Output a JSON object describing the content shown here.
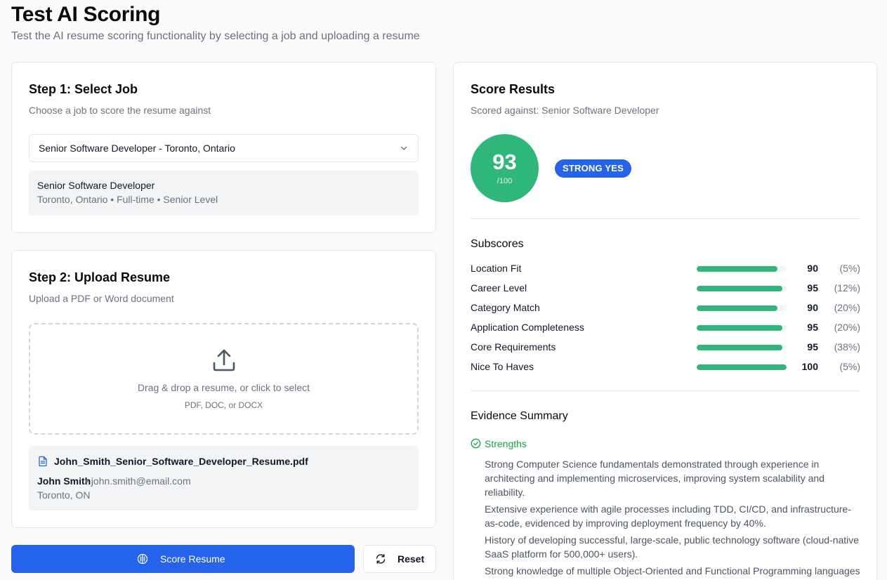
{
  "page": {
    "title": "Test AI Scoring",
    "subtitle": "Test the AI resume scoring functionality by selecting a job and uploading a resume"
  },
  "step1": {
    "title": "Step 1: Select Job",
    "description": "Choose a job to score the resume against",
    "selected_job": "Senior Software Developer - Toronto, Ontario",
    "job_title": "Senior Software Developer",
    "job_meta": "Toronto, Ontario • Full-time • Senior Level"
  },
  "step2": {
    "title": "Step 2: Upload Resume",
    "description": "Upload a PDF or Word document",
    "dropzone_text": "Drag & drop a resume, or click to select",
    "dropzone_hint": "PDF, DOC, or DOCX",
    "file_name": "John_Smith_Senior_Software_Developer_Resume.pdf",
    "candidate_name": "John Smith",
    "candidate_email": "• john.smith@email.com",
    "candidate_location": "Toronto, ON"
  },
  "actions": {
    "score_label": "Score Resume",
    "reset_label": "Reset"
  },
  "results": {
    "title": "Score Results",
    "scored_against": "Scored against: Senior Software Developer",
    "score": "93",
    "score_max": "/100",
    "recommendation": "STRONG YES",
    "subscores_title": "Subscores",
    "subscores": [
      {
        "label": "Location Fit",
        "score": 90,
        "weight": "(5%)"
      },
      {
        "label": "Career Level",
        "score": 95,
        "weight": "(12%)"
      },
      {
        "label": "Category Match",
        "score": 90,
        "weight": "(20%)"
      },
      {
        "label": "Application Completeness",
        "score": 95,
        "weight": "(20%)"
      },
      {
        "label": "Core Requirements",
        "score": 95,
        "weight": "(38%)"
      },
      {
        "label": "Nice To Haves",
        "score": 100,
        "weight": "(5%)"
      }
    ],
    "evidence_title": "Evidence Summary",
    "strengths_label": "Strengths",
    "strengths": [
      "Strong Computer Science fundamentals demonstrated through experience in architecting and implementing microservices, improving system scalability and reliability.",
      "Extensive experience with agile processes including TDD, CI/CD, and infrastructure-as-code, evidenced by improving deployment frequency by 40%.",
      "History of developing successful, large-scale, public technology software (cloud-native SaaS platform for 500,000+ users).",
      "Strong knowledge of multiple Object-Oriented and Functional Programming languages (Java, Python, JavaScript)."
    ]
  },
  "colors": {
    "primary": "#2563eb",
    "score_green": "#2fb67a",
    "strengths_green": "#16a34a"
  }
}
